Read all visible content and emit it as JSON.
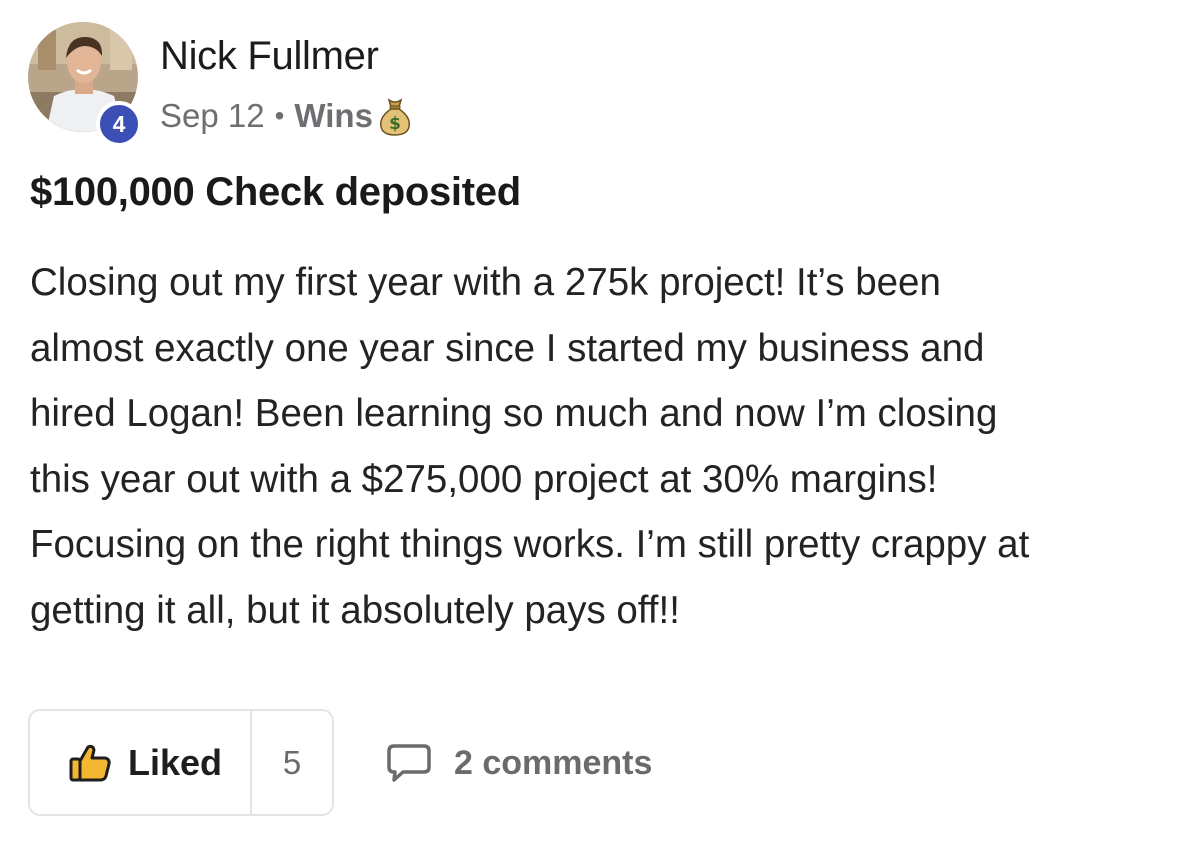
{
  "post": {
    "author": {
      "name": "Nick Fullmer",
      "level": "4",
      "avatar_icon": "profile-photo"
    },
    "meta": {
      "date": "Sep 12",
      "separator": "•",
      "category": "Wins",
      "category_icon": "money-bag-icon"
    },
    "title": "$100,000 Check deposited",
    "body_lines": [
      "Closing out my first year with a 275k project! It’s been",
      "almost exactly one year since I started my business and",
      "hired Logan! Been learning so much and now I’m closing",
      "this year out with a $275,000 project at 30% margins!",
      "Focusing on the right things works. I’m still pretty crappy at",
      "getting it all, but it absolutely pays off!!"
    ],
    "actions": {
      "like_label": "Liked",
      "like_icon": "thumbs-up-icon",
      "like_count": "5",
      "comments_label": "2 comments",
      "comments_icon": "comment-bubble-icon"
    }
  },
  "colors": {
    "badge": "#3b4fb5",
    "meta_text": "#6e6e73",
    "like_icon_fill": "#f5b731",
    "border": "#e4e4e6"
  }
}
